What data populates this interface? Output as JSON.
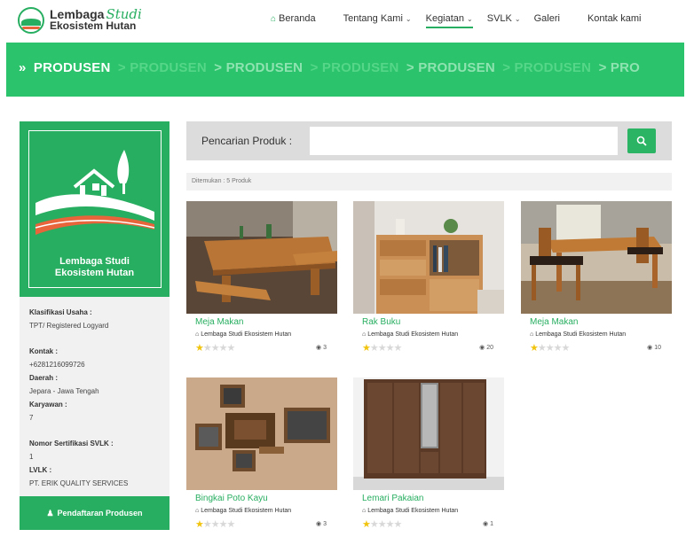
{
  "brand": {
    "line1": "Lembaga",
    "line1_script": "Studi",
    "line2": "Ekosistem Hutan"
  },
  "nav": {
    "items": [
      {
        "label": "Beranda",
        "icon": "home-icon"
      },
      {
        "label": "Tentang Kami",
        "dropdown": true
      },
      {
        "label": "Kegiatan",
        "dropdown": true,
        "active": true
      },
      {
        "label": "SVLK",
        "dropdown": true
      },
      {
        "label": "Galeri"
      },
      {
        "label": "Kontak kami"
      }
    ]
  },
  "banner": {
    "arrow": "»",
    "strip": [
      "PRODUSEN",
      "> PRODUSEN",
      "> PRODUSEN",
      "> PRODUSEN",
      "> PRODUSEN",
      "> PRODUSEN",
      "> PRO"
    ],
    "colors": {
      "bg": "#2bc36b",
      "strong": "#ffffff",
      "faint": "#55d688"
    }
  },
  "sidebar": {
    "org_name": "Lembaga Studi Ekosistem Hutan",
    "fields": {
      "klasifikasi_label": "Klasifikasi Usaha :",
      "klasifikasi_value": "TPT/ Registered Logyard",
      "kontak_label": "Kontak :",
      "kontak_value": "+6281216099726",
      "daerah_label": "Daerah :",
      "daerah_value": "Jepara - Jawa Tengah",
      "karyawan_label": "Karyawan :",
      "karyawan_value": "7",
      "sertifikasi_label": "Nomor Sertifikasi SVLK :",
      "sertifikasi_value": "1",
      "lvlk_label": "LVLK :",
      "lvlk_value": "PT. ERIK QUALITY SERVICES"
    },
    "register_button": "Pendaftaran Produsen"
  },
  "search": {
    "label": "Pencarian Produk :",
    "value": "",
    "placeholder": "",
    "found_text": "Ditemukan : 5 Produk"
  },
  "products": [
    {
      "title": "Meja Makan",
      "seller": "Lembaga Studi Ekosistem Hutan",
      "rating": 1,
      "views": "3",
      "image": "dining-table-bench"
    },
    {
      "title": "Rak Buku",
      "seller": "Lembaga Studi Ekosistem Hutan",
      "rating": 1,
      "views": "20",
      "image": "bookshelf"
    },
    {
      "title": "Meja Makan",
      "seller": "Lembaga Studi Ekosistem Hutan",
      "rating": 1,
      "views": "10",
      "image": "dining-set-chairs"
    },
    {
      "title": "Bingkai Poto Kayu",
      "seller": "Lembaga Studi Ekosistem Hutan",
      "rating": 1,
      "views": "3",
      "image": "wooden-photo-frames"
    },
    {
      "title": "Lemari Pakaian",
      "seller": "Lembaga Studi Ekosistem Hutan",
      "rating": 1,
      "views": "1",
      "image": "wardrobe"
    }
  ],
  "colors": {
    "accent": "#27ae60",
    "star": "#f1c40f",
    "search_bg": "#dcdcdc",
    "sidebar_bg": "#f1f1f1"
  }
}
